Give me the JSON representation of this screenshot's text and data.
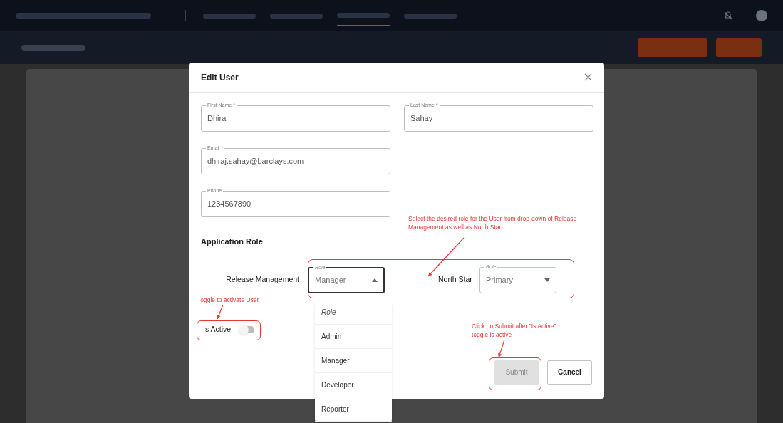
{
  "nav": {
    "tabs": [
      {
        "selected": false
      },
      {
        "selected": false
      },
      {
        "selected": true
      },
      {
        "selected": false
      }
    ]
  },
  "dialog": {
    "title": "Edit User",
    "fields": [
      {
        "label": "First Name *",
        "value": "Dhiraj"
      },
      {
        "label": "Last Name *",
        "value": "Sahay"
      },
      {
        "label": "Email *",
        "value": "dhiraj.sahay@barclays.com"
      },
      {
        "label": "Phone",
        "value": "1234567890"
      }
    ],
    "section_title": "Application Role",
    "roles": [
      {
        "app": "Release Management",
        "label": "Role",
        "value": "Manager",
        "expanded": true
      },
      {
        "app": "North Star",
        "label": "Role",
        "value": "Primary",
        "expanded": false
      }
    ],
    "dropdown_options": [
      {
        "kind": "placeholder",
        "label": "Role"
      },
      {
        "kind": "option",
        "label": "Admin"
      },
      {
        "kind": "option",
        "label": "Manager"
      },
      {
        "kind": "option",
        "label": "Developer"
      },
      {
        "kind": "option",
        "label": "Reporter"
      }
    ],
    "is_active": {
      "label": "Is Active:",
      "on": false
    },
    "buttons": [
      {
        "label": "Submit",
        "disabled": true
      },
      {
        "label": "Cancel",
        "disabled": false
      }
    ]
  },
  "annotations": [
    {
      "text": "Select the desired role for the User from drop-down of Release Management as well as North Star"
    },
    {
      "text": "Toggle to activate User"
    },
    {
      "text": "Click on Submit after \"Is Active\" toggle is active"
    }
  ]
}
